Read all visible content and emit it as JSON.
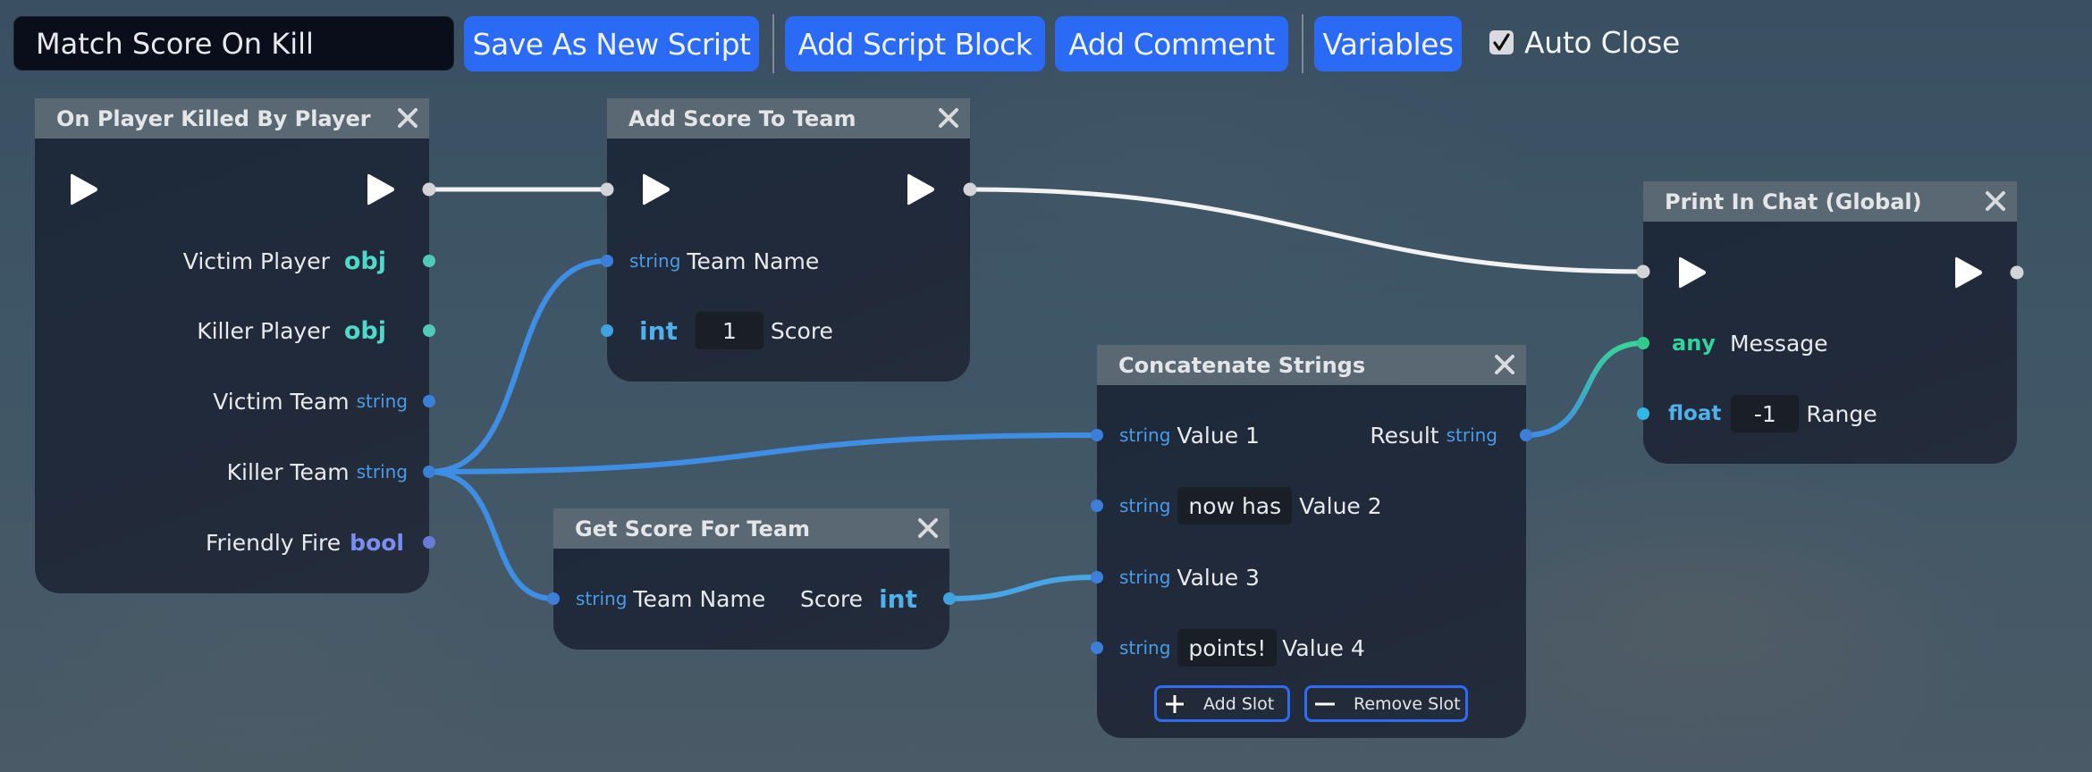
{
  "toolbar": {
    "script_name": "Match Score On Kill",
    "save_as_new": "Save As New Script",
    "add_script_block": "Add Script Block",
    "add_comment": "Add Comment",
    "variables": "Variables",
    "auto_close_label": "Auto Close",
    "auto_close_checked": true
  },
  "colors": {
    "accent": "#2a6af5",
    "exec_wire": "#f2f2f2",
    "string_wire": "#3f8ee6",
    "int_wire": "#48a6e6",
    "any_wire": "#3ad29b"
  },
  "nodes": {
    "on_killed": {
      "title": "On Player Killed By Player",
      "outputs": [
        {
          "label": "Victim Player",
          "type": "obj"
        },
        {
          "label": "Killer Player",
          "type": "obj"
        },
        {
          "label": "Victim Team",
          "type": "string"
        },
        {
          "label": "Killer Team",
          "type": "string"
        },
        {
          "label": "Friendly Fire",
          "type": "bool"
        }
      ]
    },
    "add_score": {
      "title": "Add Score To Team",
      "inputs": [
        {
          "label": "Team Name",
          "type": "string"
        },
        {
          "label": "Score",
          "type": "int",
          "value": "1"
        }
      ]
    },
    "get_score": {
      "title": "Get Score For Team",
      "input": {
        "label": "Team Name",
        "type": "string"
      },
      "output": {
        "label": "Score",
        "type": "int"
      }
    },
    "concat": {
      "title": "Concatenate Strings",
      "inputs": [
        {
          "label": "Value 1",
          "type": "string"
        },
        {
          "label": "Value 2",
          "type": "string",
          "value": "now has"
        },
        {
          "label": "Value 3",
          "type": "string"
        },
        {
          "label": "Value 4",
          "type": "string",
          "value": "points!"
        }
      ],
      "output": {
        "label": "Result",
        "type": "string"
      },
      "add_slot": "Add Slot",
      "remove_slot": "Remove Slot"
    },
    "print_chat": {
      "title": "Print In Chat (Global)",
      "inputs": [
        {
          "label": "Message",
          "type": "any"
        },
        {
          "label": "Range",
          "type": "float",
          "value": "-1"
        }
      ]
    }
  },
  "connections": [
    {
      "from": "on_killed.exec_out",
      "to": "add_score.exec_in",
      "kind": "exec"
    },
    {
      "from": "add_score.exec_out",
      "to": "print_chat.exec_in",
      "kind": "exec"
    },
    {
      "from": "on_killed.Killer Team",
      "to": "add_score.Team Name",
      "kind": "string"
    },
    {
      "from": "on_killed.Killer Team",
      "to": "concat.Value 1",
      "kind": "string"
    },
    {
      "from": "on_killed.Killer Team",
      "to": "get_score.Team Name",
      "kind": "string"
    },
    {
      "from": "get_score.Score",
      "to": "concat.Value 3",
      "kind": "int"
    },
    {
      "from": "concat.Result",
      "to": "print_chat.Message",
      "kind": "string-to-any"
    }
  ]
}
